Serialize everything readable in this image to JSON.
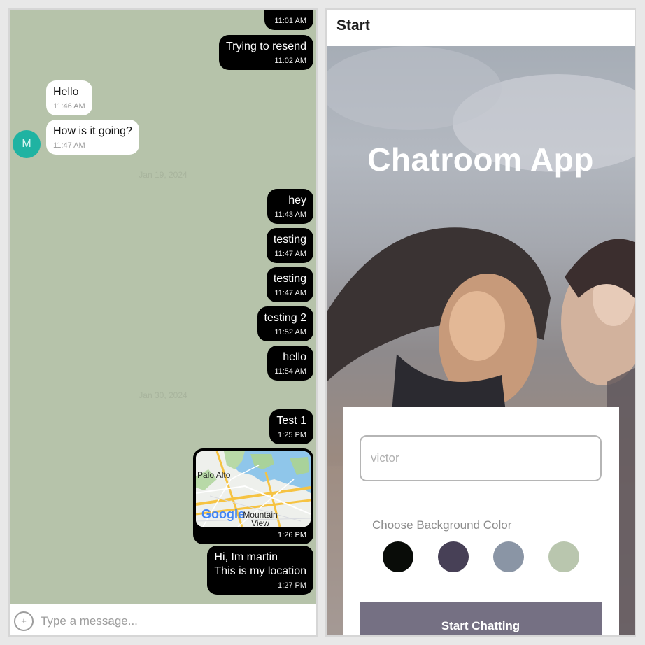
{
  "chat": {
    "messages_out_top": [
      {
        "text": "",
        "time": "11:01 AM"
      },
      {
        "text": "Trying to resend",
        "time": "11:02 AM"
      }
    ],
    "avatar_initial": "M",
    "messages_in": [
      {
        "text": "Hello",
        "time": "11:46 AM"
      },
      {
        "text": "How is it going?",
        "time": "11:47 AM"
      }
    ],
    "date_1": "Jan 19, 2024",
    "messages_out_1": [
      {
        "text": "hey",
        "time": "11:43 AM"
      },
      {
        "text": "testing",
        "time": "11:47 AM"
      },
      {
        "text": "testing",
        "time": "11:47 AM"
      },
      {
        "text": "testing 2",
        "time": "11:52 AM"
      },
      {
        "text": "hello",
        "time": "11:54 AM"
      }
    ],
    "date_2": "Jan 30, 2024",
    "messages_out_2": [
      {
        "text": "Test 1",
        "time": "1:25 PM"
      }
    ],
    "location": {
      "map_label_1": "Palo Alto",
      "map_label_2": "Mountain View",
      "map_brand": "Google",
      "time": "1:26 PM"
    },
    "last_message": {
      "text": "Hi, Im martin\nThis is my location",
      "time": "1:27 PM"
    },
    "composer": {
      "placeholder": "Type a message...",
      "plus_icon": "+"
    }
  },
  "start": {
    "appbar_title": "Start",
    "app_title": "Chatroom App",
    "name_placeholder": "victor",
    "color_label": "Choose Background Color",
    "colors": [
      "#090c08",
      "#474056",
      "#8a95a5",
      "#b9c6ae"
    ],
    "button_label": "Start Chatting"
  }
}
